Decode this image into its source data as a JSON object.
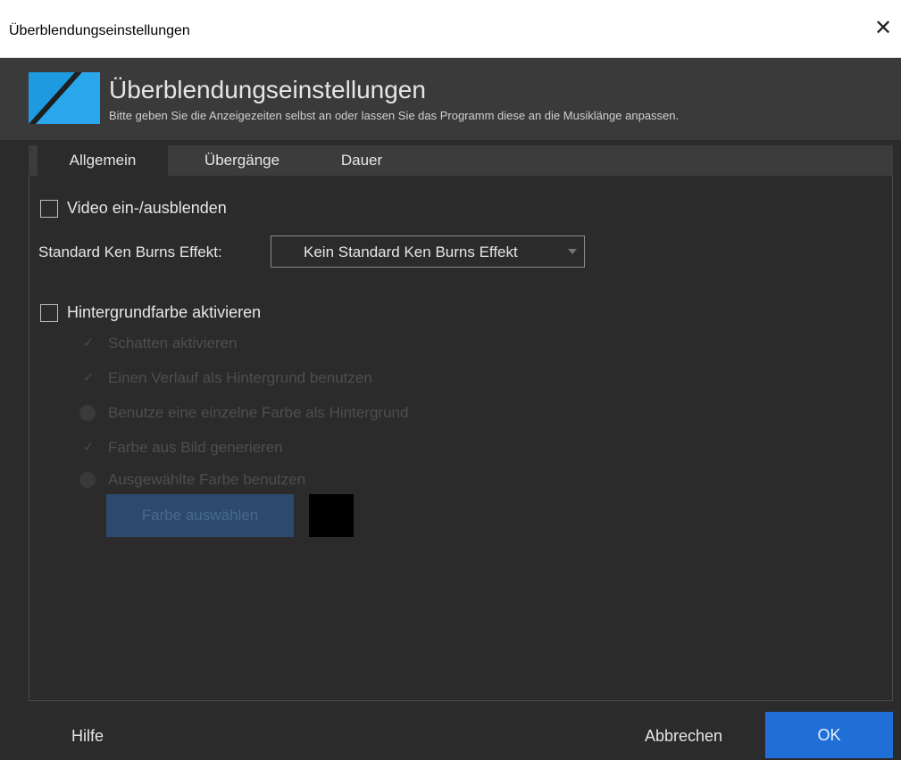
{
  "window": {
    "title": "Überblendungseinstellungen",
    "close_icon": "close-icon"
  },
  "header": {
    "title": "Überblendungseinstellungen",
    "subtitle": "Bitte geben Sie die Anzeigezeiten selbst an oder lassen Sie das Programm diese an die Musiklänge anpassen.",
    "logo_icon": "transition-logo-icon"
  },
  "tabs": [
    {
      "label": "Allgemein",
      "active": true
    },
    {
      "label": "Übergänge",
      "active": false
    },
    {
      "label": "Dauer",
      "active": false
    }
  ],
  "general": {
    "video_fade_label": "Video ein-/ausblenden",
    "video_fade_checked": false,
    "ken_burns_label": "Standard Ken Burns Effekt:",
    "ken_burns_value": "Kein Standard Ken Burns Effekt",
    "bg_color_label": "Hintergrundfarbe aktivieren",
    "bg_color_checked": false,
    "sub_options": [
      {
        "label": "Schatten aktivieren",
        "type": "check",
        "checked": true,
        "enabled": false
      },
      {
        "label": "Einen Verlauf als Hintergrund benutzen",
        "type": "radio",
        "checked": true,
        "enabled": false
      },
      {
        "label": "Benutze eine einzelne Farbe als Hintergrund",
        "type": "radio",
        "checked": false,
        "enabled": false
      },
      {
        "label": "Farbe aus Bild generieren",
        "type": "radio",
        "checked": true,
        "enabled": false
      },
      {
        "label": "Ausgewählte Farbe benutzen",
        "type": "radio",
        "checked": false,
        "enabled": false
      }
    ],
    "color_button_label": "Farbe auswählen",
    "selected_color": "#000000"
  },
  "footer": {
    "help_label": "Hilfe",
    "cancel_label": "Abbrechen",
    "ok_label": "OK"
  },
  "colors": {
    "accent": "#1f6fd6",
    "background": "#2b2b2b",
    "header_bg": "#3a3a3a"
  }
}
